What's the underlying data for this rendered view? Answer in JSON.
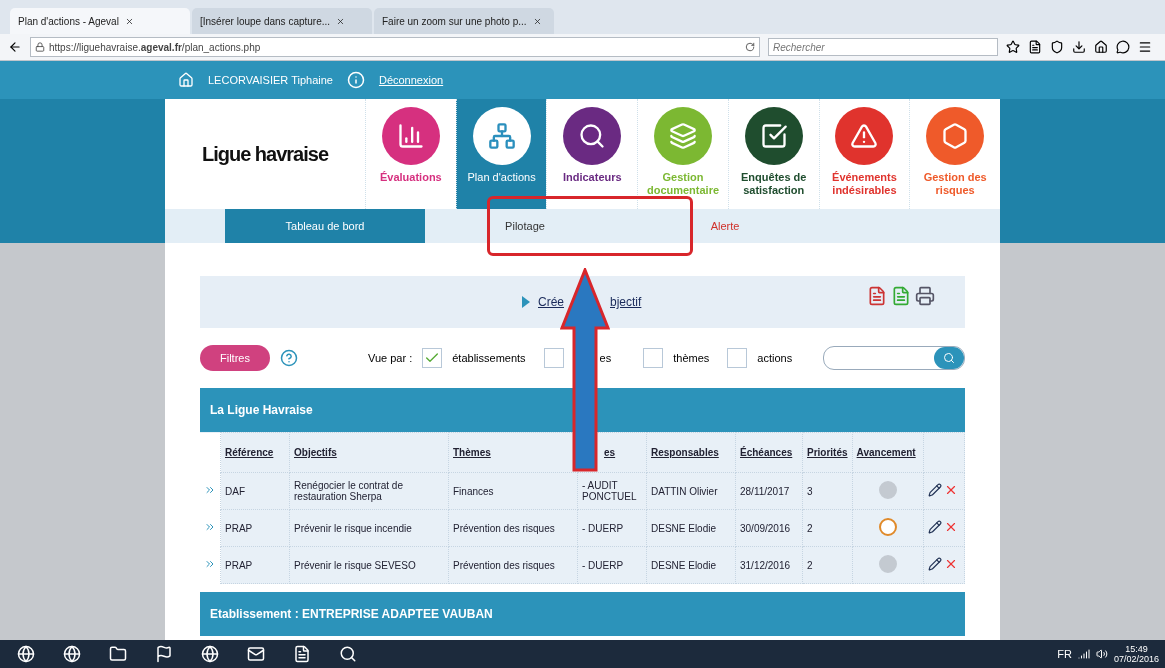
{
  "browser": {
    "tabs": [
      {
        "label": "Plan d'actions - Ageval",
        "selected": true
      },
      {
        "label": "[Insérer loupe dans capture...",
        "selected": false
      },
      {
        "label": "Faire un zoom sur une photo p...",
        "selected": false
      }
    ],
    "url_host": "https://liguehavraise.",
    "url_domain": "ageval.fr",
    "url_path": "/plan_actions.php",
    "search_placeholder": "Rechercher"
  },
  "user_bar": {
    "user": "LECORVAISIER Tiphaine",
    "logout": "Déconnexion"
  },
  "logo": {
    "name": "Ligue havraise"
  },
  "modules": [
    {
      "label": "Évaluations",
      "color": "#d6307f",
      "selected": false
    },
    {
      "label": "Plan d'actions",
      "color": "#2a8fbd",
      "selected": true
    },
    {
      "label": "Indicateurs",
      "color": "#6a2a82",
      "selected": false
    },
    {
      "label": "Gestion documentaire",
      "color": "#7cb832",
      "selected": false
    },
    {
      "label": "Enquêtes de satisfaction",
      "color": "#1f4d2e",
      "selected": false
    },
    {
      "label": "Événements indésirables",
      "color": "#e0332d",
      "selected": false
    },
    {
      "label": "Gestion des risques",
      "color": "#ef5a2a",
      "selected": false
    }
  ],
  "subnav": [
    {
      "label": "Tableau de bord",
      "selected": true,
      "kind": "normal"
    },
    {
      "label": "Pilotage",
      "selected": false,
      "kind": "normal"
    },
    {
      "label": "Alerte",
      "selected": false,
      "kind": "alert"
    }
  ],
  "create": {
    "left": "Crée",
    "right": "bjectif"
  },
  "filters": {
    "button": "Filtres",
    "view_label": "Vue par :",
    "options": [
      {
        "label": "établissements",
        "checked": true
      },
      {
        "label": "es",
        "checked": false
      },
      {
        "label": "thèmes",
        "checked": false
      },
      {
        "label": "actions",
        "checked": false
      }
    ]
  },
  "sections": [
    {
      "title": "La Ligue Havraise",
      "columns": [
        "Référence",
        "Objectifs",
        "Thèmes",
        "es",
        "Responsables",
        "Échéances",
        "Priorités",
        "Avancement"
      ],
      "rows": [
        {
          "cells": [
            "DAF",
            "Renégocier le contrat de restauration Sherpa",
            "Finances",
            "- AUDIT PONCTUEL",
            "DATTIN Olivier",
            "28/11/2017",
            "3"
          ],
          "color": "#c4cad1"
        },
        {
          "cells": [
            "PRAP",
            "Prévenir le risque incendie",
            "Prévention des risques",
            "- DUERP",
            "DESNE Elodie",
            "30/09/2016",
            "2"
          ],
          "color": "#e08a2a"
        },
        {
          "cells": [
            "PRAP",
            "Prévenir le risque SEVESO",
            "Prévention des risques",
            "- DUERP",
            "DESNE Elodie",
            "31/12/2016",
            "2"
          ],
          "color": "#c4cad1"
        }
      ]
    },
    {
      "title": "Etablissement : ENTREPRISE ADAPTEE VAUBAN"
    }
  ],
  "taskbar": {
    "lang": "FR",
    "time": "15:49",
    "date": "07/02/2016"
  }
}
